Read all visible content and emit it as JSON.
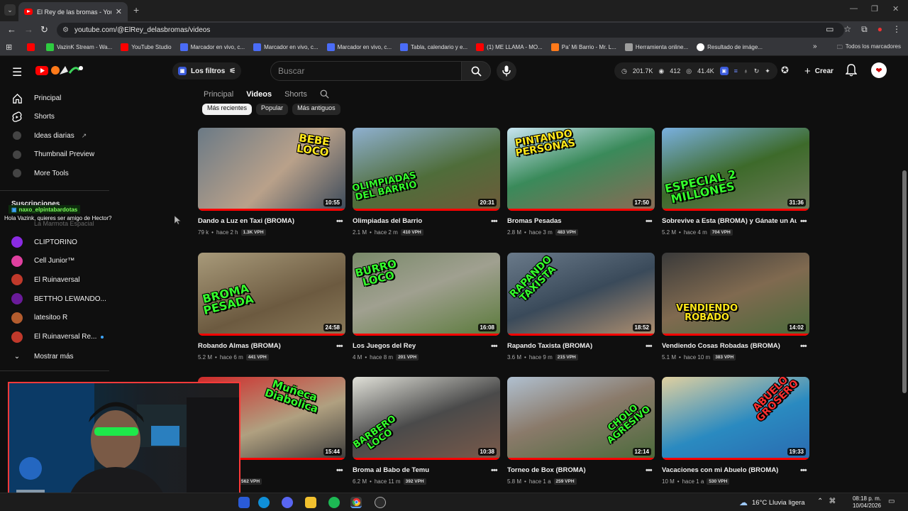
{
  "browser": {
    "tab_title": "El Rey de las bromas - YouTube",
    "new_tab": "+",
    "url": "youtube.com/@ElRey_delasbromas/videos",
    "bookmarks": [
      {
        "label": "",
        "color": "#ff0000"
      },
      {
        "label": "VazinK Stream - Wa...",
        "color": "#2ecc40"
      },
      {
        "label": "YouTube Studio",
        "color": "#ff0000"
      },
      {
        "label": "Marcador en vivo, c...",
        "color": "#4a6cf7"
      },
      {
        "label": "Marcador en vivo, c...",
        "color": "#4a6cf7"
      },
      {
        "label": "Marcador en vivo, c...",
        "color": "#4a6cf7"
      },
      {
        "label": "Tabla, calendario y e...",
        "color": "#4a6cf7"
      },
      {
        "label": "(1) ME LLAMA - MO...",
        "color": "#ff0000"
      },
      {
        "label": "Pa' Mi Barrio - Mr. L...",
        "color": "#ff7a1a"
      },
      {
        "label": "Herramienta online...",
        "color": "#9e9e9e"
      },
      {
        "label": "Resultado de imáge...",
        "color": "#ffffff"
      }
    ],
    "all_bookmarks": "Todos los marcadores"
  },
  "header": {
    "filters_label": "Los filtros",
    "search_placeholder": "Buscar",
    "stats": {
      "views": "201.7K",
      "eye": "412",
      "subs": "41.4K"
    },
    "create_label": "Crear"
  },
  "sidebar": {
    "items": [
      {
        "label": "Principal",
        "icon": "home-icon"
      },
      {
        "label": "Shorts",
        "icon": "shorts-icon"
      },
      {
        "label": "Ideas diarias",
        "icon": "ideas-icon"
      },
      {
        "label": "Thumbnail Preview",
        "icon": "thumbnail-icon"
      },
      {
        "label": "More Tools",
        "icon": "tools-icon"
      }
    ],
    "subscriptions_title": "Suscripciones",
    "hidden_channel": "La Marmota Espacial",
    "channels": [
      {
        "label": "CLIPTORINO",
        "color": "#8a2be2"
      },
      {
        "label": "Cell Junior™",
        "color": "#e040a0"
      },
      {
        "label": "El Ruinaversal",
        "color": "#c0392b"
      },
      {
        "label": "BETTHO LEWANDO...",
        "color": "#6a1b9a"
      },
      {
        "label": "latesitoo R",
        "color": "#b35c2e"
      },
      {
        "label": "El Ruinaversal Re...",
        "color": "#c0392b"
      }
    ],
    "show_more": "Mostrar más"
  },
  "chat": {
    "user": "naxo_elpintabardotas",
    "message": "Hola Vazink, quieres ser amigo de Hector?"
  },
  "channel_tabs": [
    "Principal",
    "Videos",
    "Shorts"
  ],
  "chips": [
    "Más recientes",
    "Popular",
    "Más antiguos"
  ],
  "videos": [
    {
      "title": "Dando a Luz en Taxi (BROMA)",
      "views": "79 k",
      "age": "hace 2 h",
      "vph": "1.3K VPH",
      "duration": "10:55",
      "overlay": "BEBE\nLOCO"
    },
    {
      "title": "Olimpiadas del Barrio",
      "views": "2.1 M",
      "age": "hace 2 m",
      "vph": "410 VPH",
      "duration": "20:31",
      "overlay": "OLIMPIADAS\nDEL BARRIO"
    },
    {
      "title": "Bromas Pesadas",
      "views": "2.8 M",
      "age": "hace 3 m",
      "vph": "483 VPH",
      "duration": "17:50",
      "overlay": "PINTANDO\nPERSONAS"
    },
    {
      "title": "Sobrevive a Esta (BROMA) y Gánate un Auto",
      "views": "5.2 M",
      "age": "hace 4 m",
      "vph": "704 VPH",
      "duration": "31:36",
      "overlay": "ESPECIAL 2\nMILLONES"
    },
    {
      "title": "Robando Almas (BROMA)",
      "views": "5.2 M",
      "age": "hace 6 m",
      "vph": "441 VPH",
      "duration": "24:58",
      "overlay": "BROMA\nPESADA"
    },
    {
      "title": "Los Juegos del Rey",
      "views": "4 M",
      "age": "hace 8 m",
      "vph": "201 VPH",
      "duration": "16:08",
      "overlay": "BURRO\nLOCO"
    },
    {
      "title": "Rapando Taxista (BROMA)",
      "views": "3.6 M",
      "age": "hace 9 m",
      "vph": "215 VPH",
      "duration": "18:52",
      "overlay": "RAPANDO\nTAXISTA"
    },
    {
      "title": "Vendiendo Cosas Robadas (BROMA)",
      "views": "5.1 M",
      "age": "hace 10 m",
      "vph": "383 VPH",
      "duration": "14:02",
      "overlay": "VENDIENDO\nROBADO"
    },
    {
      "title": "",
      "views": "",
      "age": "",
      "vph": "562 VPH",
      "duration": "15:44",
      "overlay": "Muñeca\nDiabolica"
    },
    {
      "title": "Broma al Babo de Temu",
      "views": "6.2 M",
      "age": "hace 11 m",
      "vph": "392 VPH",
      "duration": "10:38",
      "overlay": "BARBERO\nLOCO"
    },
    {
      "title": "Torneo de Box (BROMA)",
      "views": "5.8 M",
      "age": "hace 1 a",
      "vph": "259 VPH",
      "duration": "12:14",
      "overlay": "CHOLO\nAGRESIVO"
    },
    {
      "title": "Vacaciones con mi Abuelo (BROMA)",
      "views": "10 M",
      "age": "hace 1 a",
      "vph": "530 VPH",
      "duration": "19:33",
      "overlay": "ABUELO\nGROSERO"
    }
  ],
  "taskbar": {
    "weather": "16°C  Lluvia ligera",
    "time": "08:18 p. m.",
    "date": "10/04/2026"
  }
}
